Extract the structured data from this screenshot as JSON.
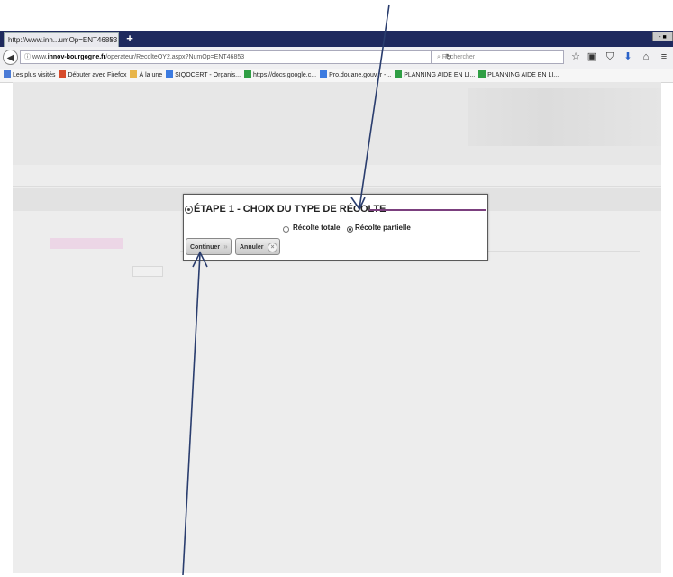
{
  "browser": {
    "tab_title": "http://www.inn...umOp=ENT46853",
    "tab_close": "×",
    "new_tab": "+",
    "window_buttons": "- ■",
    "url_prefix": "www.",
    "url_domain": "innov-bourgogne.fr",
    "url_path": "/operateur/RecolteOY2.aspx?NumOp=ENT46853",
    "search_placeholder": "Rechercher",
    "bookmarks": [
      {
        "label": "Les plus visités",
        "color": "#4a7bd6"
      },
      {
        "label": "Débuter avec Firefox",
        "color": "#d64a2a"
      },
      {
        "label": "À la une",
        "color": "#e8b54a"
      },
      {
        "label": "SIQOCERT - Organis...",
        "color": "#3c7be0"
      },
      {
        "label": "https://docs.google.c...",
        "color": "#2f9e44"
      },
      {
        "label": "Pro.douane.gouv.fr -...",
        "color": "#3c7be0"
      },
      {
        "label": "PLANNING AIDE EN LI...",
        "color": "#2f9e44"
      },
      {
        "label": "PLANNING AIDE EN LI...",
        "color": "#2f9e44"
      }
    ]
  },
  "dialog": {
    "title": "ÉTAPE 1 - CHOIX DU TYPE DE RÉCOLTE",
    "option_total": "Récolte totale",
    "option_partial": "Récolte partielle",
    "selected_option": "Récolte partielle",
    "continue_label": "Continuer",
    "cancel_label": "Annuler",
    "accent_color": "#7b3f7e"
  }
}
